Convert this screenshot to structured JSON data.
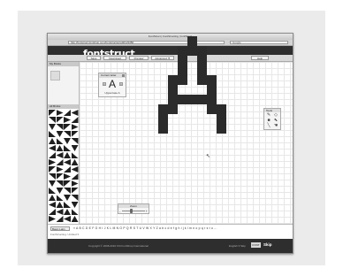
{
  "browser": {
    "title": "FontStruct | FontStructing | fontStruct",
    "url": "http://fontstruct.fontshop.com/fontstructor/edit/123456",
    "search_placeholder": "Google",
    "nav": [
      "◀",
      "▶",
      "+"
    ]
  },
  "header": {
    "logo": "fontstruct",
    "tabs": [
      {
        "label": "My FontStruct"
      },
      {
        "label": "Gallery"
      },
      {
        "label": "FontStructor"
      },
      {
        "label": "Info"
      },
      {
        "label": "Blog"
      },
      {
        "label": "Forum"
      }
    ],
    "active_tab": 2
  },
  "toolbar": {
    "save_label": "Save",
    "download_label": "Download",
    "preview_label": "Preview",
    "advanced_label": "Advanced ▼",
    "help_label": "Help"
  },
  "sidebar": {
    "bricks_title": "My Bricks",
    "all_bricks_title": "All Bricks"
  },
  "font_panel": {
    "title": "Current letter",
    "character": "A",
    "glyph_name": "Uppercase A",
    "prev": "‹",
    "next": "›"
  },
  "tools_panel": {
    "title": "Tools",
    "icons": [
      "pencil-icon",
      "eraser-icon",
      "fill-icon",
      "select-icon",
      "line-icon",
      "hand-icon"
    ]
  },
  "zoom_panel": {
    "title": "Zoom",
    "min": "-",
    "max": "+",
    "value": 0.4
  },
  "charset": {
    "selected": "Basic Latin",
    "alphabet": "« A B C D E F G H I J K L M N O P Q R S T U V W X Y Z a b c d e f g h i j k l m n o p q r s t u ..."
  },
  "status": "FontStructing: Untitled ▾",
  "footer": {
    "copyright": "Copyright © 2008-2010 FSI FontShop International",
    "lang": "English ▾ Skip",
    "badge": "FONT",
    "skip": "Skip"
  }
}
